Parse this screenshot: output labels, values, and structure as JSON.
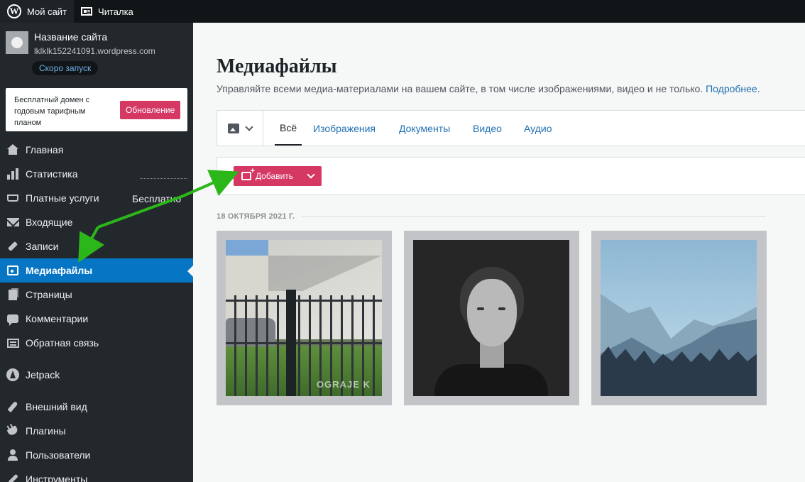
{
  "topbar": {
    "my_site_label": "Мой сайт",
    "reader_label": "Читалка"
  },
  "site": {
    "title": "Название сайта",
    "url": "lklklk152241091.wordpress.com",
    "quick_start_label": "Скоро запуск"
  },
  "upsell": {
    "text": "Бесплатный домен с годовым тарифным планом",
    "button_label": "Обновление"
  },
  "sidebar": {
    "items": [
      {
        "label": "Главная",
        "icon": "home-icon"
      },
      {
        "label": "Статистика",
        "icon": "stats-icon"
      },
      {
        "label": "Платные услуги",
        "icon": "cart-icon",
        "extra": "Бесплатно"
      },
      {
        "label": "Входящие",
        "icon": "inbox-icon"
      },
      {
        "label": "Записи",
        "icon": "pin-icon"
      },
      {
        "label": "Медиафайлы",
        "icon": "media-icon",
        "active": true
      },
      {
        "label": "Страницы",
        "icon": "pages-icon"
      },
      {
        "label": "Комментарии",
        "icon": "comments-icon"
      },
      {
        "label": "Обратная связь",
        "icon": "feedback-icon"
      },
      {
        "label": "Jetpack",
        "icon": "jetpack-icon"
      },
      {
        "label": "Внешний вид",
        "icon": "appearance-icon"
      },
      {
        "label": "Плагины",
        "icon": "plugins-icon"
      },
      {
        "label": "Пользователи",
        "icon": "users-icon"
      },
      {
        "label": "Инструменты",
        "icon": "tools-icon"
      }
    ]
  },
  "main": {
    "title": "Медиафайлы",
    "subtitle": "Управляйте всеми медиа-материалами на вашем сайте, в том числе изображениями, видео и не только.",
    "subtitle_link": "Подробнее.",
    "tabs": [
      {
        "label": "Всё",
        "active": true
      },
      {
        "label": "Изображения"
      },
      {
        "label": "Документы"
      },
      {
        "label": "Видео"
      },
      {
        "label": "Аудио"
      }
    ],
    "add_button_label": "Добавить",
    "date_label": "18 ОКТЯБРЯ 2021 Г.",
    "media": [
      {
        "subject": "fence photo",
        "watermark": "OGRAJE K"
      },
      {
        "subject": "portrait photo"
      },
      {
        "subject": "mountain landscape photo"
      }
    ]
  },
  "colors": {
    "accent": "#d63864",
    "sidebar_bg": "#23282d",
    "active_item": "#0675c4",
    "link": "#2271b1",
    "annotation_arrow": "#2bb619"
  }
}
